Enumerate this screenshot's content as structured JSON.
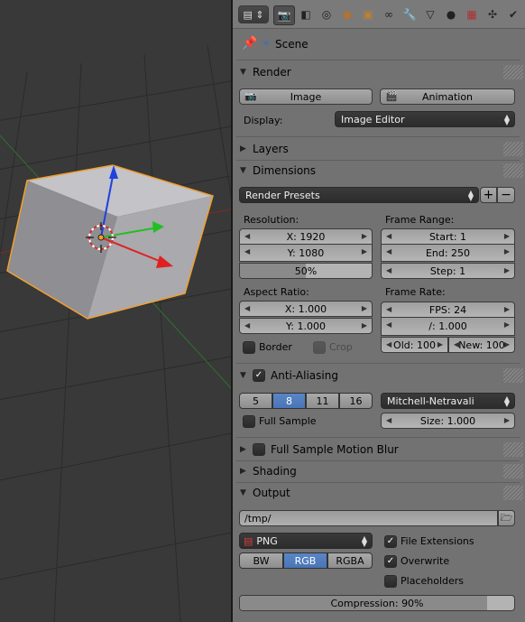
{
  "header": {
    "tabs": [
      {
        "icon": "render-icon",
        "active": true
      },
      {
        "icon": "render-layers-icon"
      },
      {
        "icon": "scene-icon"
      },
      {
        "icon": "world-icon"
      },
      {
        "icon": "object-icon"
      },
      {
        "icon": "constraints-icon"
      },
      {
        "icon": "modifiers-icon"
      },
      {
        "icon": "data-icon"
      },
      {
        "icon": "material-icon"
      },
      {
        "icon": "texture-icon"
      },
      {
        "icon": "particles-icon"
      },
      {
        "icon": "physics-icon"
      }
    ]
  },
  "context": {
    "scene_label": "Scene"
  },
  "render": {
    "title": "Render",
    "image_label": "Image",
    "animation_label": "Animation",
    "display_label": "Display:",
    "display_value": "Image Editor"
  },
  "layers": {
    "title": "Layers"
  },
  "dimensions": {
    "title": "Dimensions",
    "presets": "Render Presets",
    "resolution_label": "Resolution:",
    "res_x": "X: 1920",
    "res_y": "Y: 1080",
    "res_pct": "50%",
    "res_pct_value": 0.5,
    "frame_range_label": "Frame Range:",
    "start": "Start: 1",
    "end": "End: 250",
    "step": "Step: 1",
    "aspect_label": "Aspect Ratio:",
    "aspect_x": "X: 1.000",
    "aspect_y": "Y: 1.000",
    "frame_rate_label": "Frame Rate:",
    "fps": "FPS: 24",
    "fps_base": "/: 1.000",
    "border_label": "Border",
    "crop_label": "Crop",
    "old": "Old: 100",
    "new": "New: 100"
  },
  "antialiasing": {
    "title": "Anti-Aliasing",
    "samples": [
      "5",
      "8",
      "11",
      "16"
    ],
    "selected": "8",
    "filter": "Mitchell-Netravali",
    "full_sample_label": "Full Sample",
    "size": "Size: 1.000"
  },
  "motion_blur": {
    "title": "Full Sample Motion Blur"
  },
  "shading": {
    "title": "Shading"
  },
  "output": {
    "title": "Output",
    "path": "/tmp/",
    "format": "PNG",
    "color_modes": [
      "BW",
      "RGB",
      "RGBA"
    ],
    "color_selected": "RGB",
    "file_extensions_label": "File Extensions",
    "overwrite_label": "Overwrite",
    "placeholders_label": "Placeholders",
    "compression": "Compression: 90%",
    "compression_value": 0.9
  },
  "colors": {
    "accent": "#5680c2",
    "selection": "#f0a030",
    "bg_viewport": "#393939",
    "panel": "#727272"
  }
}
